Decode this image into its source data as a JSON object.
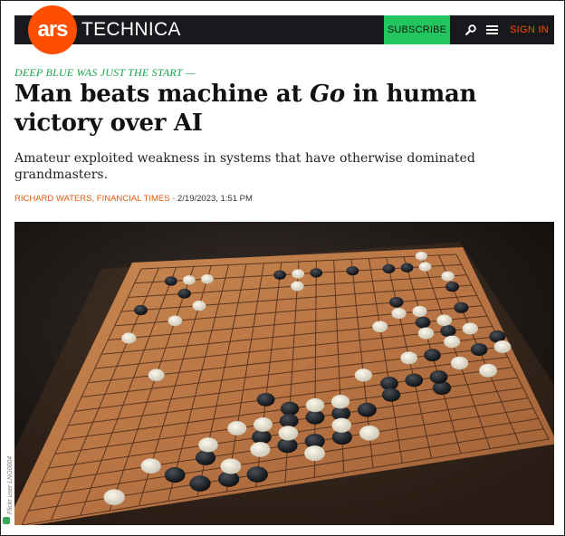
{
  "header": {
    "logo_ars": "ars",
    "logo_tech": "TECHNICA",
    "subscribe_label": "SUBSCRIBE",
    "signin_label": "SIGN IN",
    "search_icon": "search-icon",
    "menu_icon": "menu-icon",
    "colors": {
      "bar": "#17191c",
      "brand": "#ff4e00",
      "subscribe": "#22c55e"
    }
  },
  "article": {
    "kicker": "DEEP BLUE WAS JUST THE START —",
    "title_before": "Man beats machine at ",
    "title_em": "Go",
    "title_after": " in human victory over AI",
    "dek": "Amateur exploited weakness in systems that have otherwise dominated grandmasters.",
    "author": "RICHARD WATERS, FINANCIAL TIMES",
    "separator": " - ",
    "date": "2/19/2023, 1:51 PM"
  },
  "image": {
    "subject": "go-board-photo",
    "credit": "Flickr user LNG0004"
  }
}
